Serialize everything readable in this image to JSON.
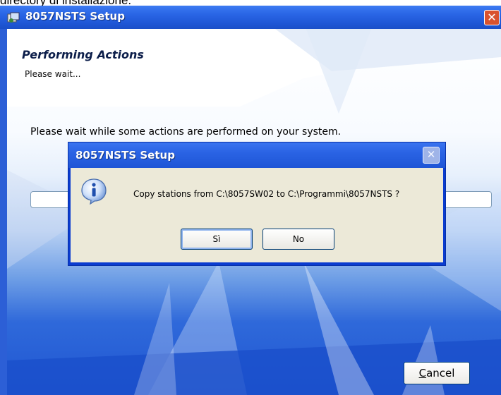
{
  "caption": "directory di installazione.",
  "window": {
    "title": "8057NSTS Setup",
    "close_glyph": "✕",
    "icon": "setup-app-icon"
  },
  "header": {
    "title": "Performing Actions",
    "subtitle": "Please wait..."
  },
  "body": {
    "message": "Please wait while some actions are performed on your system.",
    "progress": 0
  },
  "buttons": {
    "cancel_first": "C",
    "cancel_rest": "ancel"
  },
  "dialog": {
    "title": "8057NSTS Setup",
    "close_glyph": "✕",
    "icon": "information-icon",
    "message": "Copy stations from C:\\8057SW02 to C:\\Programmi\\8057NSTS ?",
    "yes_label": "Sì",
    "no_label": "No"
  }
}
